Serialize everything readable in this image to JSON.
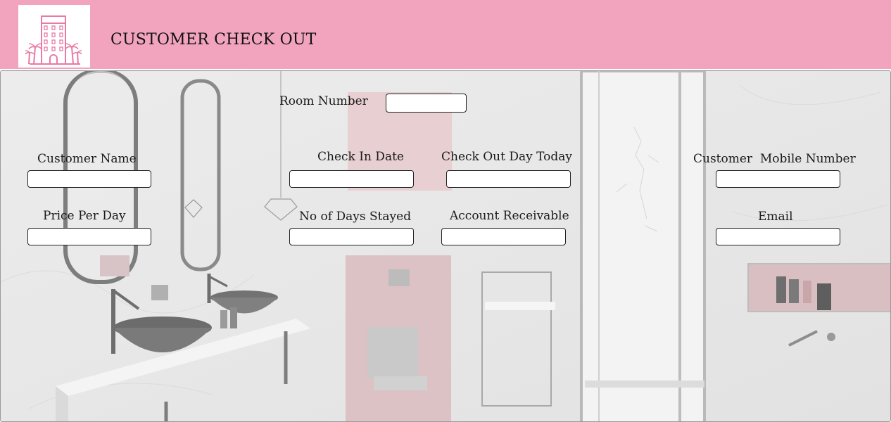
{
  "header": {
    "title": "CUSTOMER CHECK OUT",
    "logo_icon": "hotel-building-icon",
    "background": "#f2a4bf"
  },
  "form": {
    "room_number": {
      "label": "Room Number",
      "value": ""
    },
    "customer_name": {
      "label": "Customer Name",
      "value": ""
    },
    "check_in_date": {
      "label": "Check In Date",
      "value": ""
    },
    "check_out_day_today": {
      "label": "Check Out Day Today",
      "value": ""
    },
    "customer_mobile_number": {
      "label": "Customer  Mobile Number",
      "value": ""
    },
    "price_per_day": {
      "label": "Price Per Day",
      "value": ""
    },
    "no_of_days_stayed": {
      "label": "No of Days Stayed",
      "value": ""
    },
    "account_receivable": {
      "label": "Account Receivable",
      "value": ""
    },
    "email": {
      "label": "Email",
      "value": ""
    }
  },
  "colors": {
    "accent_pink": "#f2a4bf",
    "logo_pink": "#e97aa3"
  }
}
